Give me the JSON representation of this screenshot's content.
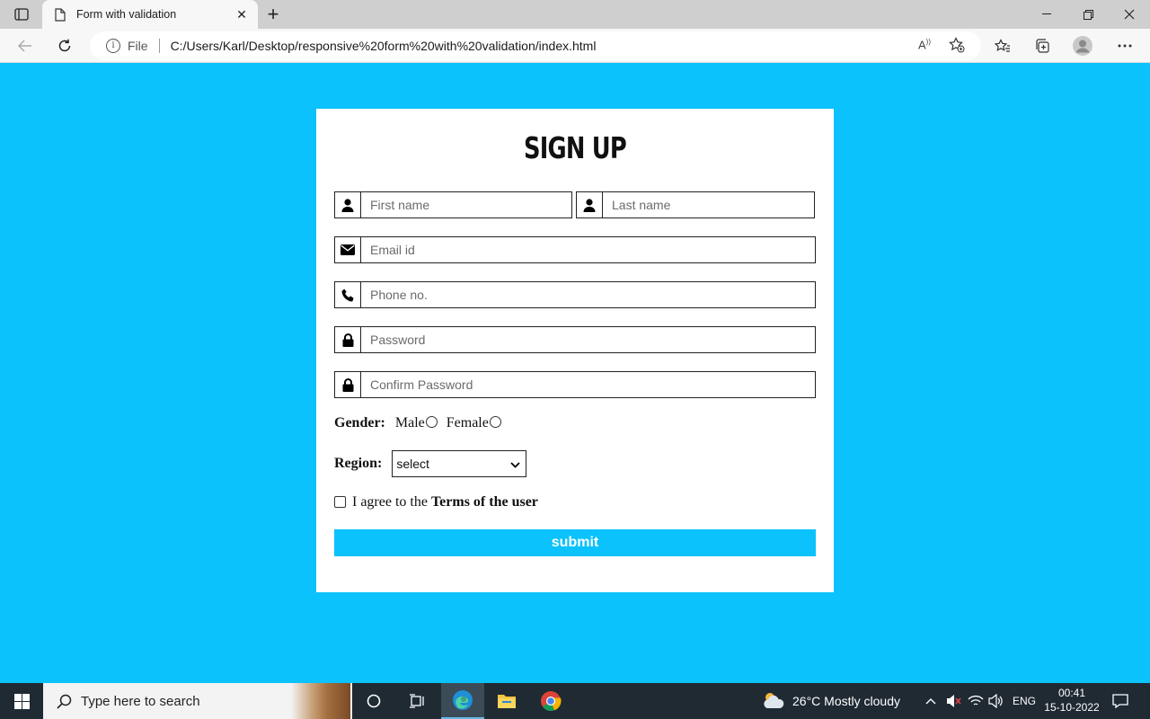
{
  "browser": {
    "tab_title": "Form with validation",
    "file_label": "File",
    "url": "C:/Users/Karl/Desktop/responsive%20form%20with%20validation/index.html",
    "icons": [
      "tab-actions-icon",
      "page-icon",
      "close-icon",
      "plus-icon",
      "back-icon",
      "refresh-icon",
      "info-icon",
      "read-aloud-icon",
      "add-favorite-icon",
      "favorites-icon",
      "collections-icon",
      "profile-icon",
      "more-icon"
    ]
  },
  "form": {
    "title": "SIGN UP",
    "first_name_placeholder": "First name",
    "last_name_placeholder": "Last name",
    "email_placeholder": "Email id",
    "phone_placeholder": "Phone no.",
    "password_placeholder": "Password",
    "confirm_password_placeholder": "Confirm Password",
    "gender_label": "Gender:",
    "gender_options": [
      "Male",
      "Female"
    ],
    "region_label": "Region:",
    "region_selected": "select",
    "terms_prefix": "I agree to the",
    "terms_link": "Terms of the user",
    "submit_label": "submit",
    "accent_color": "#0bc2fc"
  },
  "taskbar": {
    "search_placeholder": "Type here to search",
    "weather": "26°C  Mostly cloudy",
    "language": "ENG",
    "time": "00:41",
    "date": "15-10-2022"
  }
}
